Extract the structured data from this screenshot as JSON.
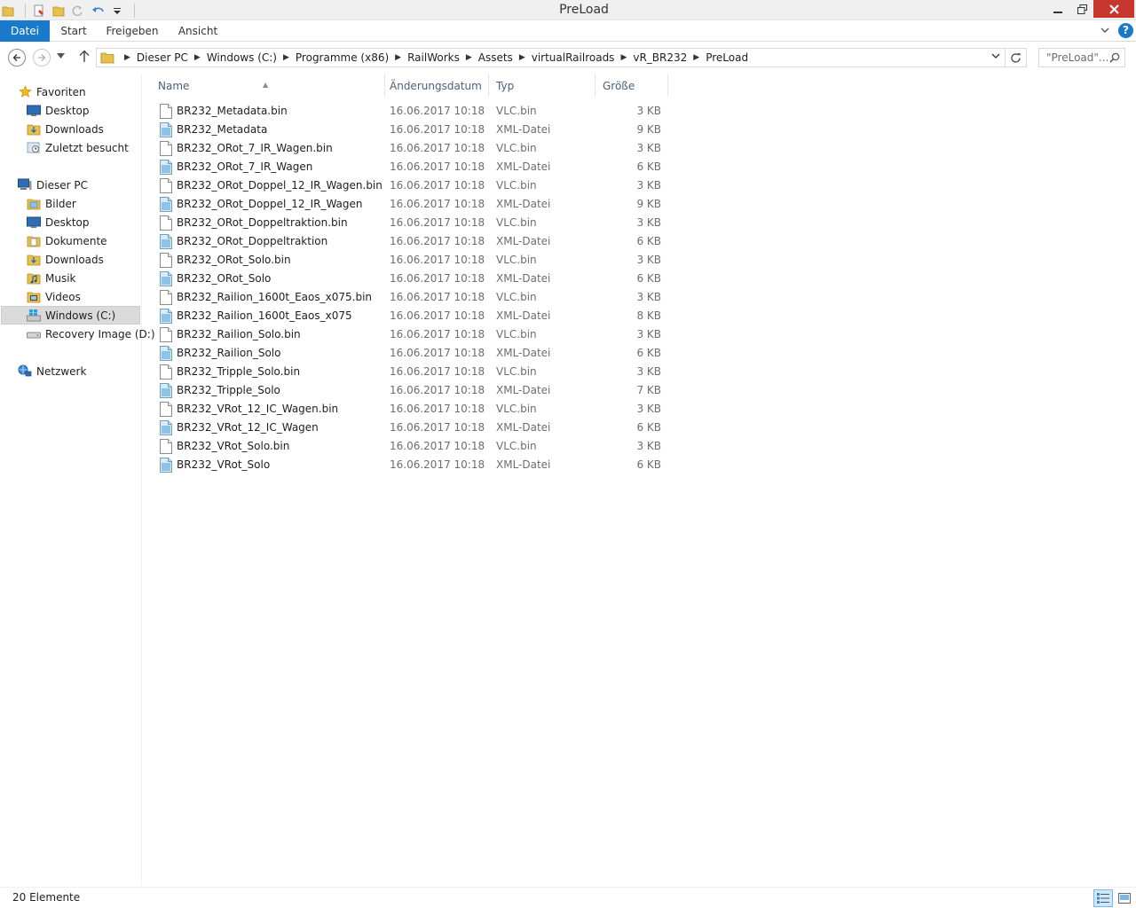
{
  "window": {
    "title": "PreLoad"
  },
  "ribbon": {
    "tabs": [
      "Datei",
      "Start",
      "Freigeben",
      "Ansicht"
    ],
    "help": "?"
  },
  "address": {
    "crumbs": [
      "Dieser PC",
      "Windows (C:)",
      "Programme (x86)",
      "RailWorks",
      "Assets",
      "virtualRailroads",
      "vR_BR232",
      "PreLoad"
    ]
  },
  "search": {
    "placeholder": "\"PreLoad\"..."
  },
  "sidebar": {
    "favorites": {
      "label": "Favoriten",
      "items": [
        "Desktop",
        "Downloads",
        "Zuletzt besucht"
      ]
    },
    "thispc": {
      "label": "Dieser PC",
      "items": [
        "Bilder",
        "Desktop",
        "Dokumente",
        "Downloads",
        "Musik",
        "Videos",
        "Windows (C:)",
        "Recovery Image (D:)"
      ]
    },
    "network": {
      "label": "Netzwerk"
    }
  },
  "columns": {
    "name": "Name",
    "date": "Änderungsdatum",
    "type": "Typ",
    "size": "Größe"
  },
  "files": [
    {
      "name": "BR232_Metadata.bin",
      "date": "16.06.2017 10:18",
      "type": "VLC.bin",
      "size": "3 KB",
      "kind": "bin"
    },
    {
      "name": "BR232_Metadata",
      "date": "16.06.2017 10:18",
      "type": "XML-Datei",
      "size": "9 KB",
      "kind": "xml"
    },
    {
      "name": "BR232_ORot_7_IR_Wagen.bin",
      "date": "16.06.2017 10:18",
      "type": "VLC.bin",
      "size": "3 KB",
      "kind": "bin"
    },
    {
      "name": "BR232_ORot_7_IR_Wagen",
      "date": "16.06.2017 10:18",
      "type": "XML-Datei",
      "size": "6 KB",
      "kind": "xml"
    },
    {
      "name": "BR232_ORot_Doppel_12_IR_Wagen.bin",
      "date": "16.06.2017 10:18",
      "type": "VLC.bin",
      "size": "3 KB",
      "kind": "bin"
    },
    {
      "name": "BR232_ORot_Doppel_12_IR_Wagen",
      "date": "16.06.2017 10:18",
      "type": "XML-Datei",
      "size": "9 KB",
      "kind": "xml"
    },
    {
      "name": "BR232_ORot_Doppeltraktion.bin",
      "date": "16.06.2017 10:18",
      "type": "VLC.bin",
      "size": "3 KB",
      "kind": "bin"
    },
    {
      "name": "BR232_ORot_Doppeltraktion",
      "date": "16.06.2017 10:18",
      "type": "XML-Datei",
      "size": "6 KB",
      "kind": "xml"
    },
    {
      "name": "BR232_ORot_Solo.bin",
      "date": "16.06.2017 10:18",
      "type": "VLC.bin",
      "size": "3 KB",
      "kind": "bin"
    },
    {
      "name": "BR232_ORot_Solo",
      "date": "16.06.2017 10:18",
      "type": "XML-Datei",
      "size": "6 KB",
      "kind": "xml"
    },
    {
      "name": "BR232_Railion_1600t_Eaos_x075.bin",
      "date": "16.06.2017 10:18",
      "type": "VLC.bin",
      "size": "3 KB",
      "kind": "bin"
    },
    {
      "name": "BR232_Railion_1600t_Eaos_x075",
      "date": "16.06.2017 10:18",
      "type": "XML-Datei",
      "size": "8 KB",
      "kind": "xml"
    },
    {
      "name": "BR232_Railion_Solo.bin",
      "date": "16.06.2017 10:18",
      "type": "VLC.bin",
      "size": "3 KB",
      "kind": "bin"
    },
    {
      "name": "BR232_Railion_Solo",
      "date": "16.06.2017 10:18",
      "type": "XML-Datei",
      "size": "6 KB",
      "kind": "xml"
    },
    {
      "name": "BR232_Tripple_Solo.bin",
      "date": "16.06.2017 10:18",
      "type": "VLC.bin",
      "size": "3 KB",
      "kind": "bin"
    },
    {
      "name": "BR232_Tripple_Solo",
      "date": "16.06.2017 10:18",
      "type": "XML-Datei",
      "size": "7 KB",
      "kind": "xml"
    },
    {
      "name": "BR232_VRot_12_IC_Wagen.bin",
      "date": "16.06.2017 10:18",
      "type": "VLC.bin",
      "size": "3 KB",
      "kind": "bin"
    },
    {
      "name": "BR232_VRot_12_IC_Wagen",
      "date": "16.06.2017 10:18",
      "type": "XML-Datei",
      "size": "6 KB",
      "kind": "xml"
    },
    {
      "name": "BR232_VRot_Solo.bin",
      "date": "16.06.2017 10:18",
      "type": "VLC.bin",
      "size": "3 KB",
      "kind": "bin"
    },
    {
      "name": "BR232_VRot_Solo",
      "date": "16.06.2017 10:18",
      "type": "XML-Datei",
      "size": "6 KB",
      "kind": "xml"
    }
  ],
  "status": {
    "count": "20 Elemente"
  },
  "icons": {
    "window": "folder-icon",
    "file_bin": "blank-file-icon",
    "file_xml": "xml-file-icon"
  },
  "colors": {
    "accent": "#1979ca",
    "close": "#c7372f",
    "selection": "#dadada"
  }
}
